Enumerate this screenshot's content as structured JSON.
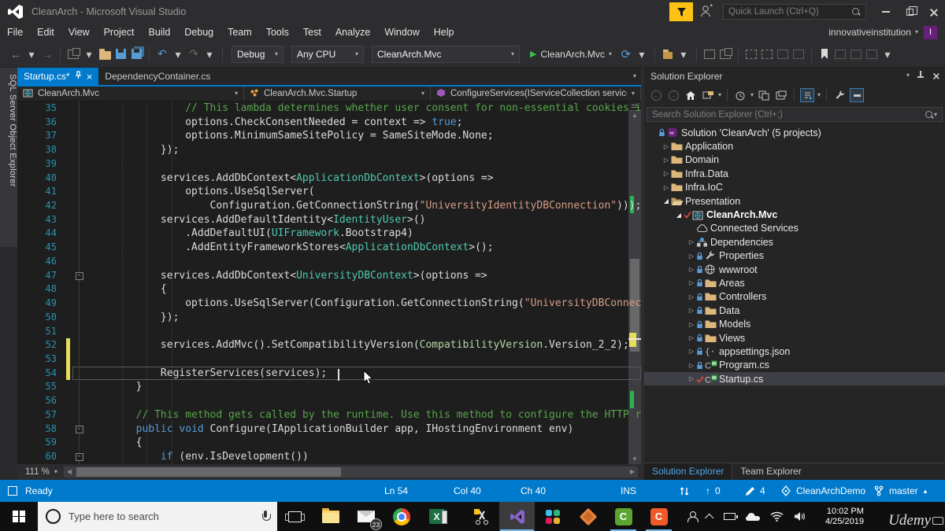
{
  "window": {
    "title": "CleanArch - Microsoft Visual Studio",
    "quick_launch_placeholder": "Quick Launch (Ctrl+Q)",
    "account": "innovativeinstitution",
    "account_initial": "I"
  },
  "menu": {
    "items": [
      "File",
      "Edit",
      "View",
      "Project",
      "Build",
      "Debug",
      "Team",
      "Tools",
      "Test",
      "Analyze",
      "Window",
      "Help"
    ]
  },
  "toolbar": {
    "configuration": "Debug",
    "platform": "Any CPU",
    "startup_project": "CleanArch.Mvc",
    "run_target": "CleanArch.Mvc"
  },
  "side_tab": {
    "label": "SQL Server Object Explorer"
  },
  "editor": {
    "tabs": [
      {
        "label": "Startup.cs*",
        "active": true
      },
      {
        "label": "DependencyContainer.cs",
        "active": false
      }
    ],
    "breadcrumbs": [
      {
        "label": "CleanArch.Mvc",
        "icon": "project"
      },
      {
        "label": "CleanArch.Mvc.Startup",
        "icon": "class"
      },
      {
        "label": "ConfigureServices(IServiceCollection services)",
        "icon": "method"
      }
    ],
    "zoom_level": "111 %",
    "code": {
      "lines": [
        {
          "n": 35,
          "ind": 16,
          "segs": [
            [
              "com",
              "// This lambda determines whether user consent for non-essential cookies i"
            ]
          ]
        },
        {
          "n": 36,
          "ind": 16,
          "segs": [
            [
              "d",
              "options.CheckConsentNeeded = context => "
            ],
            [
              "kw",
              "true"
            ],
            [
              "d",
              ";"
            ]
          ]
        },
        {
          "n": 37,
          "ind": 16,
          "segs": [
            [
              "d",
              "options.MinimumSameSitePolicy = SameSiteMode.None;"
            ]
          ]
        },
        {
          "n": 38,
          "ind": 12,
          "segs": [
            [
              "d",
              "});"
            ]
          ]
        },
        {
          "n": 39,
          "ind": 0,
          "segs": []
        },
        {
          "n": 40,
          "ind": 12,
          "segs": [
            [
              "d",
              "services.AddDbContext<"
            ],
            [
              "ty",
              "ApplicationDbContext"
            ],
            [
              "d",
              ">(options =>"
            ]
          ]
        },
        {
          "n": 41,
          "ind": 16,
          "segs": [
            [
              "d",
              "options.UseSqlServer("
            ]
          ]
        },
        {
          "n": 42,
          "ind": 20,
          "segs": [
            [
              "d",
              "Configuration.GetConnectionString("
            ],
            [
              "str",
              "\"UniversityIdentityDBConnection\""
            ],
            [
              "d",
              ")));"
            ]
          ]
        },
        {
          "n": 43,
          "ind": 12,
          "segs": [
            [
              "d",
              "services.AddDefaultIdentity<"
            ],
            [
              "ty",
              "IdentityUser"
            ],
            [
              "d",
              ">()"
            ]
          ]
        },
        {
          "n": 44,
          "ind": 16,
          "segs": [
            [
              "d",
              ".AddDefaultUI("
            ],
            [
              "ty",
              "UIFramework"
            ],
            [
              "d",
              ".Bootstrap4)"
            ]
          ]
        },
        {
          "n": 45,
          "ind": 16,
          "segs": [
            [
              "d",
              ".AddEntityFrameworkStores<"
            ],
            [
              "ty",
              "ApplicationDbContext"
            ],
            [
              "d",
              ">();"
            ]
          ]
        },
        {
          "n": 46,
          "ind": 0,
          "segs": []
        },
        {
          "n": 47,
          "ind": 12,
          "box": true,
          "segs": [
            [
              "d",
              "services.AddDbContext<"
            ],
            [
              "ty",
              "UniversityDBContext"
            ],
            [
              "d",
              ">(options =>"
            ]
          ]
        },
        {
          "n": 48,
          "ind": 12,
          "segs": [
            [
              "d",
              "{"
            ]
          ]
        },
        {
          "n": 49,
          "ind": 16,
          "segs": [
            [
              "d",
              "options.UseSqlServer(Configuration.GetConnectionString("
            ],
            [
              "str",
              "\"UniversityDBConnec"
            ]
          ]
        },
        {
          "n": 50,
          "ind": 12,
          "segs": [
            [
              "d",
              "});"
            ]
          ]
        },
        {
          "n": 51,
          "ind": 0,
          "segs": []
        },
        {
          "n": 52,
          "ind": 12,
          "chg": true,
          "segs": [
            [
              "d",
              "services.AddMvc().SetCompatibilityVersion("
            ],
            [
              "en",
              "CompatibilityVersion"
            ],
            [
              "d",
              ".Version_2_2);"
            ]
          ]
        },
        {
          "n": 53,
          "ind": 0,
          "chg": true,
          "segs": []
        },
        {
          "n": 54,
          "ind": 12,
          "chg": true,
          "cur": true,
          "segs": [
            [
              "d",
              "RegisterServices(services);"
            ]
          ]
        },
        {
          "n": 55,
          "ind": 8,
          "segs": [
            [
              "d",
              "}"
            ]
          ]
        },
        {
          "n": 56,
          "ind": 0,
          "segs": []
        },
        {
          "n": 57,
          "ind": 8,
          "segs": [
            [
              "com",
              "// This method gets called by the runtime. Use this method to configure the HTTP r"
            ]
          ]
        },
        {
          "n": 58,
          "ind": 8,
          "box": true,
          "segs": [
            [
              "kw",
              "public void "
            ],
            [
              "d",
              "Configure(IApplicationBuilder app, IHostingEnvironment env)"
            ]
          ]
        },
        {
          "n": 59,
          "ind": 8,
          "segs": [
            [
              "d",
              "{"
            ]
          ]
        },
        {
          "n": 60,
          "ind": 12,
          "box": true,
          "segs": [
            [
              "kw",
              "if"
            ],
            [
              "d",
              " (env.IsDevelopment())"
            ]
          ]
        }
      ]
    }
  },
  "solution_explorer": {
    "title": "Solution Explorer",
    "search_placeholder": "Search Solution Explorer (Ctrl+;)",
    "tree": [
      {
        "label": "Solution 'CleanArch' (5 projects)",
        "icon": "solution",
        "indent": 0,
        "arrow": "none",
        "overlay": "lock"
      },
      {
        "label": "Application",
        "icon": "folder",
        "indent": 1,
        "arrow": "collapsed",
        "overlay": "none"
      },
      {
        "label": "Domain",
        "icon": "folder",
        "indent": 1,
        "arrow": "collapsed",
        "overlay": "none"
      },
      {
        "label": "Infra.Data",
        "icon": "folder",
        "indent": 1,
        "arrow": "collapsed",
        "overlay": "none"
      },
      {
        "label": "Infra.IoC",
        "icon": "folder",
        "indent": 1,
        "arrow": "collapsed",
        "overlay": "none"
      },
      {
        "label": "Presentation",
        "icon": "folder-open",
        "indent": 1,
        "arrow": "expanded",
        "overlay": "none"
      },
      {
        "label": "CleanArch.Mvc",
        "icon": "project",
        "indent": 2,
        "arrow": "expanded",
        "overlay": "check",
        "bold": true
      },
      {
        "label": "Connected Services",
        "icon": "cloud",
        "indent": 3,
        "arrow": "none",
        "overlay": "none"
      },
      {
        "label": "Dependencies",
        "icon": "dependencies",
        "indent": 3,
        "arrow": "collapsed",
        "overlay": "none"
      },
      {
        "label": "Properties",
        "icon": "wrench",
        "indent": 3,
        "arrow": "collapsed",
        "overlay": "lock"
      },
      {
        "label": "wwwroot",
        "icon": "globe",
        "indent": 3,
        "arrow": "collapsed",
        "overlay": "lock"
      },
      {
        "label": "Areas",
        "icon": "folder",
        "indent": 3,
        "arrow": "collapsed",
        "overlay": "lock"
      },
      {
        "label": "Controllers",
        "icon": "folder",
        "indent": 3,
        "arrow": "collapsed",
        "overlay": "lock"
      },
      {
        "label": "Data",
        "icon": "folder",
        "indent": 3,
        "arrow": "collapsed",
        "overlay": "lock"
      },
      {
        "label": "Models",
        "icon": "folder",
        "indent": 3,
        "arrow": "collapsed",
        "overlay": "lock"
      },
      {
        "label": "Views",
        "icon": "folder",
        "indent": 3,
        "arrow": "collapsed",
        "overlay": "lock"
      },
      {
        "label": "appsettings.json",
        "icon": "json",
        "indent": 3,
        "arrow": "collapsed",
        "overlay": "lock"
      },
      {
        "label": "Program.cs",
        "icon": "csharp",
        "indent": 3,
        "arrow": "collapsed",
        "overlay": "lock"
      },
      {
        "label": "Startup.cs",
        "icon": "csharp",
        "indent": 3,
        "arrow": "collapsed",
        "overlay": "check",
        "selected": true
      }
    ],
    "bottom_tabs": [
      {
        "label": "Solution Explorer",
        "active": true
      },
      {
        "label": "Team Explorer",
        "active": false
      }
    ]
  },
  "status_bar": {
    "message": "Ready",
    "line": "Ln 54",
    "column": "Col 40",
    "character": "Ch 40",
    "mode": "INS",
    "pushes": "0",
    "edits": "4",
    "repository": "CleanArchDemo",
    "branch": "master"
  },
  "taskbar": {
    "search_placeholder": "Type here to search",
    "mail_badge": "23",
    "time": "10:02 PM",
    "date": "4/25/2019",
    "watermark": "Udemy"
  },
  "colors": {
    "accent": "#007ACC",
    "title_bar": "#2D2D30",
    "editor_bg": "#1E1E1E",
    "panel_bg": "#252526",
    "selection": "#3F3F46",
    "comment": "#57A64A",
    "keyword": "#569CD6",
    "type": "#4EC9B0",
    "string": "#D69D85",
    "enum": "#B8D7A3",
    "line_number": "#2B91AF",
    "modified_yellow": "#E7DC5B",
    "folder": "#DCB67A"
  },
  "icons": {
    "dropdown": "▾",
    "close": "×",
    "collapsed": "▷",
    "expanded": "◢",
    "play": "▶",
    "back": "←",
    "forward": "→",
    "undo": "↶",
    "redo": "↷",
    "refresh": "⟳",
    "up_arrow": "↑",
    "caret_up": "▴",
    "left_scroll": "◀",
    "right_scroll": "▶",
    "up_scroll": "▲",
    "down_scroll": "▼",
    "minus": "-"
  }
}
